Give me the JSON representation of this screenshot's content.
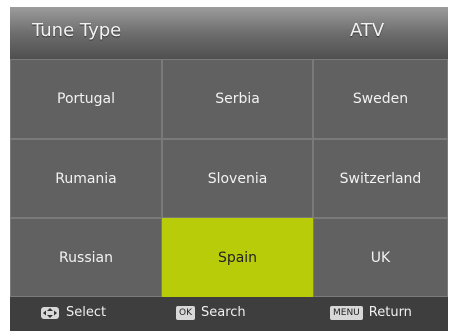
{
  "header": {
    "title": "Tune Type",
    "value": "ATV"
  },
  "countries": [
    [
      "Portugal",
      "Serbia",
      "Sweden"
    ],
    [
      "Rumania",
      "Slovenia",
      "Switzerland"
    ],
    [
      "Russian",
      "Spain",
      "UK"
    ]
  ],
  "selected": "Spain",
  "footer": {
    "select_label": "Select",
    "ok_key": "OK",
    "search_label": "Search",
    "menu_key": "MENU",
    "return_label": "Return"
  },
  "colors": {
    "selected_bg": "#b8cc0a",
    "cell_bg": "#616161"
  }
}
